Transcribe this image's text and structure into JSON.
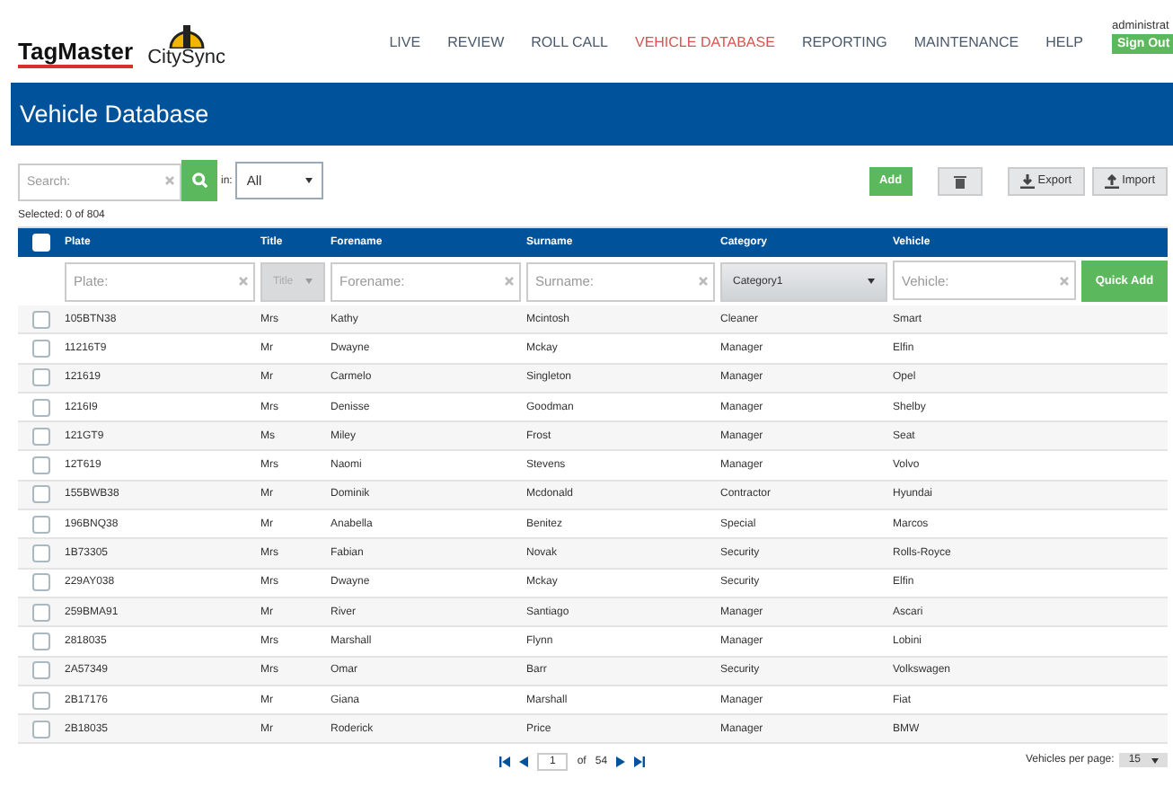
{
  "header": {
    "brand": "TagMaster",
    "sub_brand": "CitySync",
    "nav": [
      {
        "label": "LIVE",
        "selected": false
      },
      {
        "label": "REVIEW",
        "selected": false
      },
      {
        "label": "ROLL CALL",
        "selected": false
      },
      {
        "label": "VEHICLE DATABASE",
        "selected": true
      },
      {
        "label": "REPORTING",
        "selected": false
      },
      {
        "label": "MAINTENANCE",
        "selected": false
      },
      {
        "label": "HELP",
        "selected": false
      }
    ],
    "user": "administrat",
    "sign_out": "Sign Out"
  },
  "page_title": "Vehicle Database",
  "toolbar": {
    "search": {
      "placeholder": "Search:"
    },
    "in_label": "in:",
    "scope": "All",
    "add": "Add",
    "export": "Export",
    "import": "Import"
  },
  "selected_text": "Selected:  0  of  804",
  "table": {
    "columns": [
      "Plate",
      "Title",
      "Forename",
      "Surname",
      "Category",
      "Vehicle"
    ],
    "select_all_checked": false,
    "filters": {
      "plate": {
        "placeholder": "Plate:"
      },
      "title": "Title",
      "forename": {
        "placeholder": "Forename:"
      },
      "surname": {
        "placeholder": "Surname:"
      },
      "category": "Category1",
      "vehicle": {
        "placeholder": "Vehicle:"
      },
      "quick_add": "Quick Add"
    },
    "rows": [
      {
        "checked": false,
        "cells": [
          "105BTN38",
          "Mrs",
          "Kathy",
          "Mcintosh",
          "Cleaner",
          "Smart"
        ]
      },
      {
        "checked": false,
        "cells": [
          "11216T9",
          "Mr",
          "Dwayne",
          "Mckay",
          "Manager",
          "Elfin"
        ]
      },
      {
        "checked": false,
        "cells": [
          "121619",
          "Mr",
          "Carmelo",
          "Singleton",
          "Manager",
          "Opel"
        ]
      },
      {
        "checked": false,
        "cells": [
          "1216I9",
          "Mrs",
          "Denisse",
          "Goodman",
          "Manager",
          "Shelby"
        ]
      },
      {
        "checked": false,
        "cells": [
          "121GT9",
          "Ms",
          "Miley",
          "Frost",
          "Manager",
          "Seat"
        ]
      },
      {
        "checked": false,
        "cells": [
          "12T619",
          "Mrs",
          "Naomi",
          "Stevens",
          "Manager",
          "Volvo"
        ]
      },
      {
        "checked": false,
        "cells": [
          "155BWB38",
          "Mr",
          "Dominik",
          "Mcdonald",
          "Contractor",
          "Hyundai"
        ]
      },
      {
        "checked": false,
        "cells": [
          "196BNQ38",
          "Mr",
          "Anabella",
          "Benitez",
          "Special",
          "Marcos"
        ]
      },
      {
        "checked": false,
        "cells": [
          "1B73305",
          "Mrs",
          "Fabian",
          "Novak",
          "Security",
          "Rolls-Royce"
        ]
      },
      {
        "checked": false,
        "cells": [
          "229AY038",
          "Mrs",
          "Dwayne",
          "Mckay",
          "Security",
          "Elfin"
        ]
      },
      {
        "checked": false,
        "cells": [
          "259BMA91",
          "Mr",
          "River",
          "Santiago",
          "Manager",
          "Ascari"
        ]
      },
      {
        "checked": false,
        "cells": [
          "2818035",
          "Mrs",
          "Marshall",
          "Flynn",
          "Manager",
          "Lobini"
        ]
      },
      {
        "checked": false,
        "cells": [
          "2A57349",
          "Mrs",
          "Omar",
          "Barr",
          "Security",
          "Volkswagen"
        ]
      },
      {
        "checked": false,
        "cells": [
          "2B17176",
          "Mr",
          "Giana",
          "Marshall",
          "Manager",
          "Fiat"
        ]
      },
      {
        "checked": false,
        "cells": [
          "2B18035",
          "Mr",
          "Roderick",
          "Price",
          "Manager",
          "BMW"
        ]
      }
    ]
  },
  "pagination": {
    "page": "1",
    "of_label": "of",
    "total": "54",
    "per_page_label": "Vehicles per page:",
    "per_page": "15"
  }
}
